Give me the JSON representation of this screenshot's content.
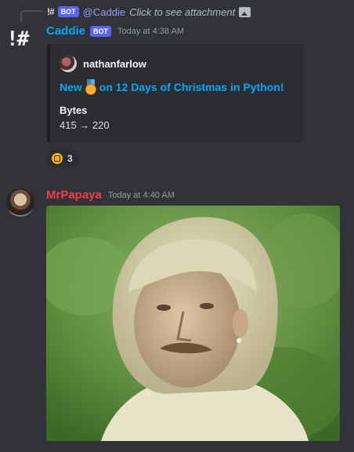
{
  "reply": {
    "avatar_glyph": "!#",
    "bot_tag": "BOT",
    "mention": "@Caddie",
    "text": "Click to see attachment"
  },
  "caddie": {
    "avatar_glyph": "!#",
    "name": "Caddie",
    "name_color": "#00a8fc",
    "bot_tag": "BOT",
    "timestamp": "Today at 4:38 AM"
  },
  "embed": {
    "author": "nathanfarlow",
    "title_before": "New",
    "title_after": "on 12 Days of Christmas in Python!",
    "field_name": "Bytes",
    "field_value": "415 → 220"
  },
  "reaction": {
    "count": "3"
  },
  "papaya": {
    "name": "MrPapaya",
    "name_color": "#f23f43",
    "timestamp": "Today at 4:40 AM"
  },
  "icons": {
    "reply_attachment": "image-icon",
    "embed_medal": "gold-medal-icon",
    "reaction": "badge-emoji-icon"
  }
}
